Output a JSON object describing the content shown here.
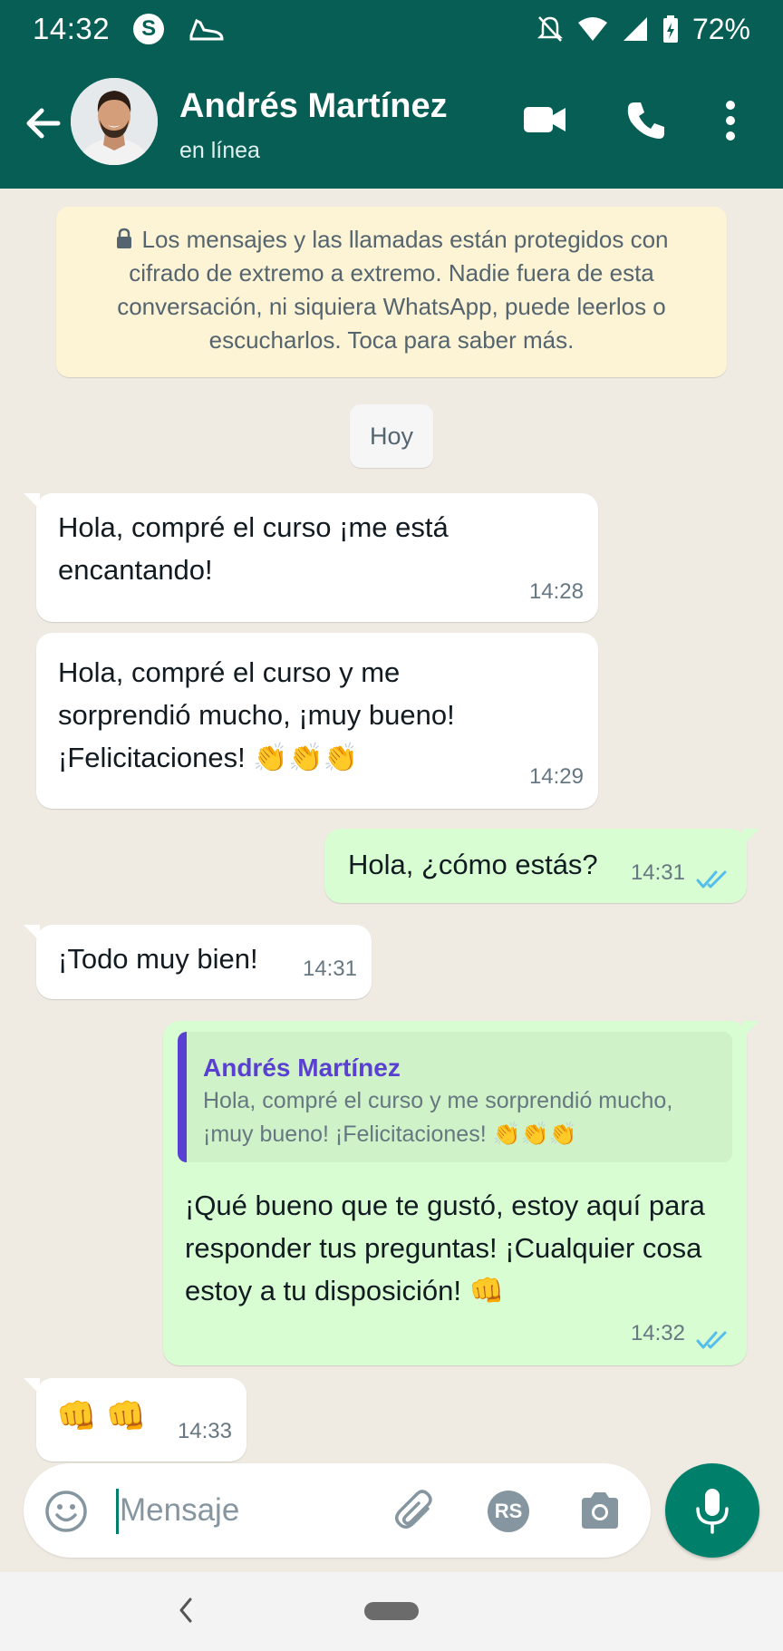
{
  "status_bar": {
    "time": "14:32",
    "battery": "72%"
  },
  "header": {
    "contact_name": "Andrés Martínez",
    "contact_status": "en línea"
  },
  "encryption_notice": "Los mensajes y las llamadas están protegidos con cifrado de extremo a extremo. Nadie fuera de esta conversación, ni siquiera WhatsApp, puede leerlos o escucharlos. Toca para saber más.",
  "date_chip": "Hoy",
  "messages": [
    {
      "direction": "in",
      "text": "Hola, compré el curso ¡me está encantando!",
      "time": "14:28"
    },
    {
      "direction": "in",
      "text": "Hola, compré el curso y me sorprendió mucho, ¡muy bueno! ¡Felicitaciones! 👏👏👏",
      "time": "14:29"
    },
    {
      "direction": "out",
      "text": "Hola, ¿cómo estás?",
      "time": "14:31",
      "status": "read"
    },
    {
      "direction": "in",
      "text": "¡Todo muy bien!",
      "time": "14:31"
    },
    {
      "direction": "out",
      "quote_author": "Andrés Martínez",
      "quote_text": "Hola, compré el curso y me sorprendió mucho, ¡muy bueno! ¡Felicitaciones! 👏👏👏",
      "text": "¡Qué bueno que te gustó, estoy aquí para responder tus preguntas! ¡Cualquier cosa estoy a tu disposición! 👊",
      "time": "14:32",
      "status": "read"
    },
    {
      "direction": "in",
      "text": "👊 👊",
      "time": "14:33"
    }
  ],
  "input": {
    "placeholder": "Mensaje",
    "rs_label": "RS"
  },
  "icons": [
    "back-arrow-icon",
    "video-call-icon",
    "phone-icon",
    "more-vert-icon",
    "emoji-icon",
    "attach-icon",
    "camera-icon",
    "mic-icon",
    "lock-icon",
    "read-ticks-icon"
  ],
  "colors": {
    "header": "#075e54",
    "outgoing_bubble": "#d9fdd3",
    "incoming_bubble": "#ffffff",
    "chat_background": "#efeae2",
    "read_ticks": "#53bdeb",
    "quote_accent": "#5a3fd3",
    "mic_button": "#00806a"
  }
}
